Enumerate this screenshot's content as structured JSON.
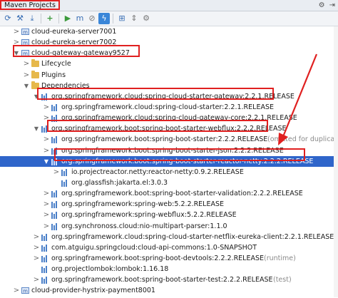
{
  "panel": {
    "title": "Maven Projects",
    "settings_icon": "gear-icon",
    "hide_icon": "hide-icon"
  },
  "toolbar": {
    "buttons": [
      "refresh-icon",
      "generate-sources-icon",
      "download-icon",
      "add-icon",
      "run-icon",
      "execute-goal-icon",
      "offline-icon",
      "skip-tests-icon",
      "show-dependencies-icon",
      "collapse-all-icon",
      "settings-icon"
    ]
  },
  "tree": [
    {
      "text": "cloud-eureka-server7001",
      "suffix": "",
      "level": 1,
      "arrow": "right",
      "icon": "module"
    },
    {
      "text": "cloud-eureka-server7002",
      "suffix": "",
      "level": 1,
      "arrow": "right",
      "icon": "module"
    },
    {
      "text": "cloud-gateway-gateway9527",
      "suffix": "",
      "level": 1,
      "arrow": "down",
      "icon": "module"
    },
    {
      "text": "Lifecycle",
      "suffix": "",
      "level": 2,
      "arrow": "right",
      "icon": "folder"
    },
    {
      "text": "Plugins",
      "suffix": "",
      "level": 2,
      "arrow": "right",
      "icon": "folder"
    },
    {
      "text": "Dependencies",
      "suffix": "",
      "level": 2,
      "arrow": "down",
      "icon": "folder"
    },
    {
      "text": "org.springframework.cloud:spring-cloud-starter-gateway:2.2.1.RELEASE",
      "suffix": "",
      "level": 3,
      "arrow": "down",
      "icon": "dep"
    },
    {
      "text": "org.springframework.cloud:spring-cloud-starter:2.2.1.RELEASE",
      "suffix": "",
      "level": 4,
      "arrow": "right",
      "icon": "dep"
    },
    {
      "text": "org.springframework.cloud:spring-cloud-gateway-core:2.2.1.RELEASE",
      "suffix": "",
      "level": 4,
      "arrow": "right",
      "icon": "dep"
    },
    {
      "text": "org.springframework.boot:spring-boot-starter-webflux:2.2.2.RELEASE",
      "suffix": "",
      "level": 3,
      "arrow": "down",
      "icon": "dep"
    },
    {
      "text": "org.springframework.boot:spring-boot-starter:2.2.2.RELEASE",
      "suffix": " (omitted for duplicate)",
      "level": 4,
      "arrow": "right",
      "icon": "dep"
    },
    {
      "text": "org.springframework.boot:spring-boot-starter-json:2.2.2.RELEASE",
      "suffix": "",
      "level": 4,
      "arrow": "right",
      "icon": "dep"
    },
    {
      "text": "org.springframework.boot:spring-boot-starter-reactor-netty:2.2.2.RELEASE",
      "suffix": "",
      "level": 4,
      "arrow": "down",
      "icon": "dep",
      "selected": true
    },
    {
      "text": "io.projectreactor.netty:reactor-netty:0.9.2.RELEASE",
      "suffix": "",
      "level": 5,
      "arrow": "right",
      "icon": "dep"
    },
    {
      "text": "org.glassfish:jakarta.el:3.0.3",
      "suffix": "",
      "level": 5,
      "arrow": "",
      "icon": "dep"
    },
    {
      "text": "org.springframework.boot:spring-boot-starter-validation:2.2.2.RELEASE",
      "suffix": "",
      "level": 4,
      "arrow": "right",
      "icon": "dep"
    },
    {
      "text": "org.springframework:spring-web:5.2.2.RELEASE",
      "suffix": "",
      "level": 4,
      "arrow": "right",
      "icon": "dep"
    },
    {
      "text": "org.springframework:spring-webflux:5.2.2.RELEASE",
      "suffix": "",
      "level": 4,
      "arrow": "right",
      "icon": "dep"
    },
    {
      "text": "org.synchronoss.cloud:nio-multipart-parser:1.1.0",
      "suffix": "",
      "level": 4,
      "arrow": "right",
      "icon": "dep"
    },
    {
      "text": "org.springframework.cloud:spring-cloud-starter-netflix-eureka-client:2.2.1.RELEASE",
      "suffix": "",
      "level": 3,
      "arrow": "right",
      "icon": "dep"
    },
    {
      "text": "com.atguigu.springcloud:cloud-api-commons:1.0-SNAPSHOT",
      "suffix": "",
      "level": 3,
      "arrow": "right",
      "icon": "dep"
    },
    {
      "text": "org.springframework.boot:spring-boot-devtools:2.2.2.RELEASE",
      "suffix": " (runtime)",
      "level": 3,
      "arrow": "right",
      "icon": "dep"
    },
    {
      "text": "org.projectlombok:lombok:1.16.18",
      "suffix": "",
      "level": 3,
      "arrow": "",
      "icon": "dep"
    },
    {
      "text": "org.springframework.boot:spring-boot-starter-test:2.2.2.RELEASE",
      "suffix": " (test)",
      "level": 3,
      "arrow": "right",
      "icon": "dep"
    },
    {
      "text": "cloud-provider-hystrix-payment8001",
      "suffix": "",
      "level": 1,
      "arrow": "right",
      "icon": "module"
    }
  ],
  "colors": {
    "highlight": "#e02020",
    "selection": "#2f65ca"
  }
}
